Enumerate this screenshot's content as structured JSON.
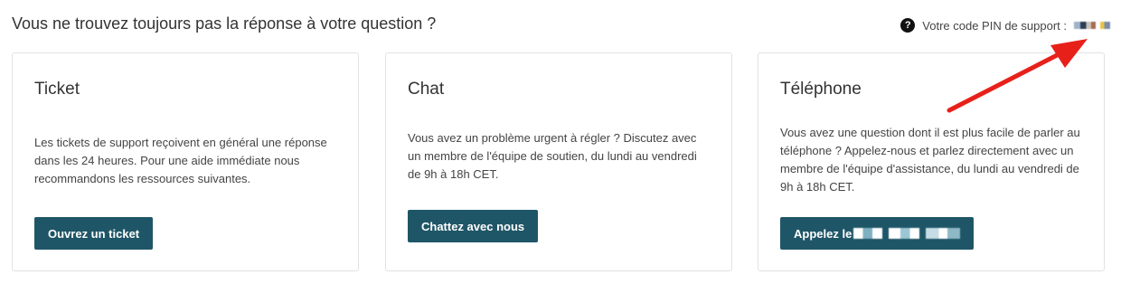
{
  "header": {
    "title": "Vous ne trouvez toujours pas la réponse à votre question ?",
    "pin_label": "Votre code PIN de support :",
    "help_icon_glyph": "?"
  },
  "cards": [
    {
      "title": "Ticket",
      "text": "Les tickets de support reçoivent en général une réponse dans les 24 heures. Pour une aide immédiate nous recommandons les ressources suivantes.",
      "button_label": "Ouvrez un ticket"
    },
    {
      "title": "Chat",
      "text": "Vous avez un problème urgent à régler ? Discutez avec un membre de l'équipe de soutien, du lundi au vendredi de 9h à 18h CET.",
      "button_label": "Chattez avec nous"
    },
    {
      "title": "Téléphone",
      "text": "Vous avez une question dont il est plus facile de parler au téléphone ? Appelez-nous et parlez directement avec un membre de l'équipe d'assistance, du lundi au vendredi de 9h à 18h CET.",
      "button_label": "Appelez le"
    }
  ],
  "colors": {
    "button_bg": "#1f5667",
    "arrow": "#e8201a",
    "border": "#e2e2e2"
  },
  "icons": {
    "help": "question-circle-icon",
    "annotation": "red-arrow"
  }
}
